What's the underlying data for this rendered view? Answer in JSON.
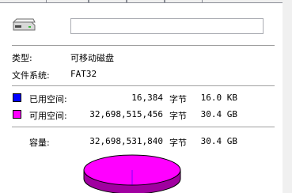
{
  "general": {
    "type_label": "类型:",
    "type_value": "可移动磁盘",
    "fs_label": "文件系统:",
    "fs_value": "FAT32"
  },
  "used": {
    "label": "已用空间:",
    "bytes": "16,384",
    "unit": "字节",
    "size": "16.0 KB",
    "color": "#0000ff"
  },
  "free": {
    "label": "可用空间:",
    "bytes": "32,698,515,456",
    "unit": "字节",
    "size": "30.4 GB",
    "color": "#ff00ff"
  },
  "capacity": {
    "label": "容量:",
    "bytes": "32,698,531,840",
    "unit": "字节",
    "size": "30.4 GB"
  },
  "pie": {
    "used_fraction": 5e-07,
    "free_color": "#ff00ff",
    "side_color": "#a000a0"
  },
  "icons": {
    "drive": "removable-drive-icon"
  }
}
